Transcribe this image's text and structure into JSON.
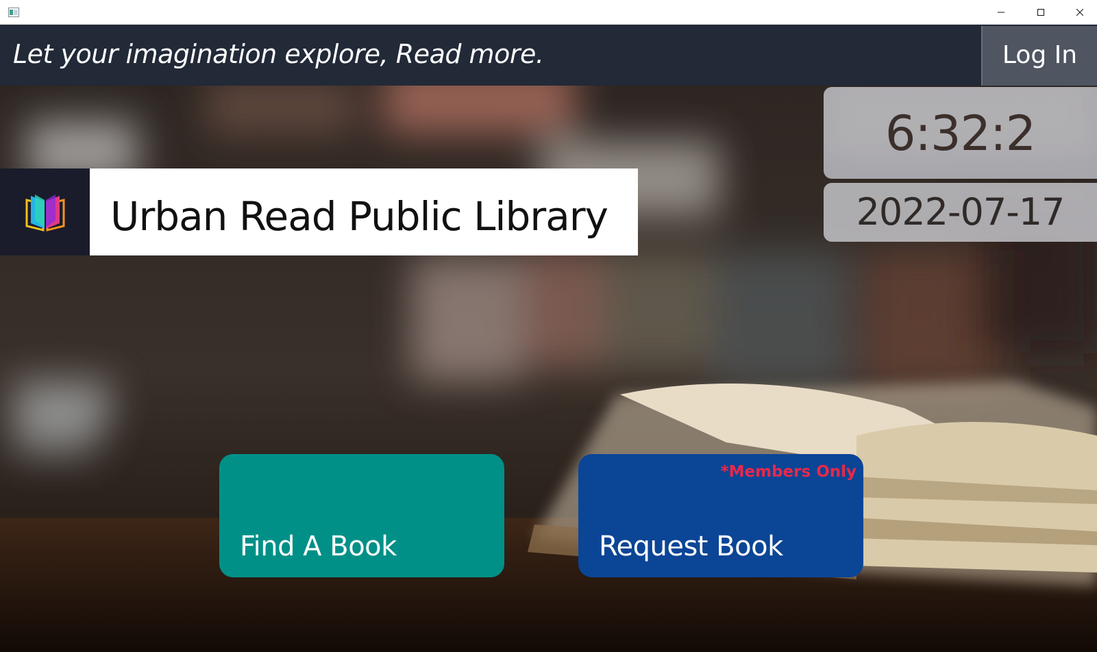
{
  "window": {
    "icon": "app-window-icon",
    "controls": [
      "minimize-icon",
      "maximize-icon",
      "close-icon"
    ]
  },
  "banner": {
    "tagline": "Let your imagination explore, Read more.",
    "login_label": "Log In"
  },
  "clock": {
    "time": "6:32:2",
    "date": "2022-07-17"
  },
  "library": {
    "logo_icon": "open-book-logo-icon",
    "name": "Urban Read Public Library"
  },
  "actions": {
    "find": {
      "label": "Find A Book",
      "color": "#009087"
    },
    "request": {
      "label": "Request Book",
      "note": "*Members Only",
      "color": "#0b4596",
      "note_color": "#e8294a"
    }
  },
  "colors": {
    "banner": "#222937",
    "login_button": "#4f5662",
    "logo_background": "#1a1c2b"
  }
}
